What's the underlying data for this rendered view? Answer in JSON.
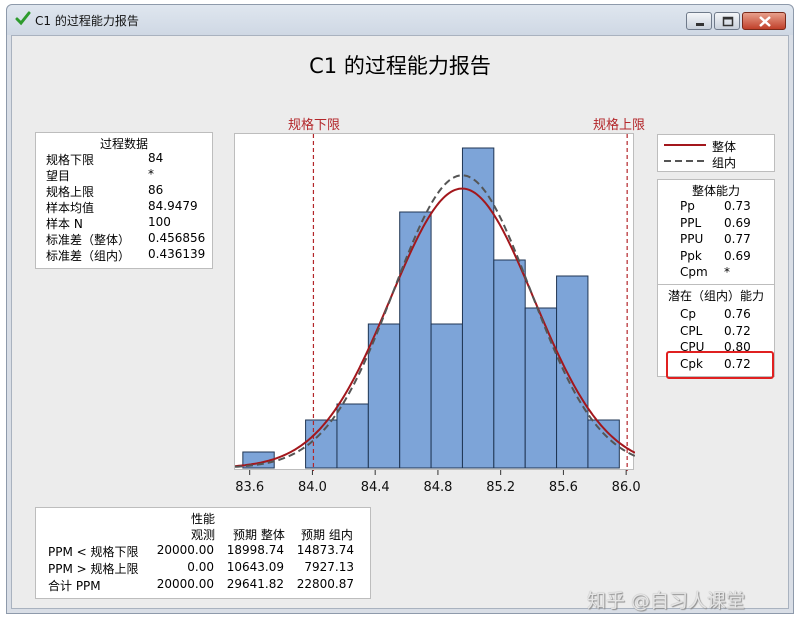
{
  "window": {
    "title": "C1 的过程能力报告"
  },
  "report": {
    "title": "C1 的过程能力报告"
  },
  "process_data": {
    "title": "过程数据",
    "rows": [
      {
        "label": "规格下限",
        "value": "84"
      },
      {
        "label": "望目",
        "value": "*"
      },
      {
        "label": "规格上限",
        "value": "86"
      },
      {
        "label": "样本均值",
        "value": "84.9479"
      },
      {
        "label": "样本 N",
        "value": "100"
      },
      {
        "label": "标准差（整体）",
        "value": "0.456856"
      },
      {
        "label": "标准差（组内）",
        "value": "0.436139"
      }
    ]
  },
  "legend": {
    "items": [
      {
        "label": "整体",
        "style": "solid",
        "color": "#a3171c"
      },
      {
        "label": "组内",
        "style": "dashed",
        "color": "#555555"
      }
    ]
  },
  "overall_capability": {
    "title": "整体能力",
    "rows": [
      {
        "label": "Pp",
        "value": "0.73"
      },
      {
        "label": "PPL",
        "value": "0.69"
      },
      {
        "label": "PPU",
        "value": "0.77"
      },
      {
        "label": "Ppk",
        "value": "0.69"
      },
      {
        "label": "Cpm",
        "value": "*"
      }
    ]
  },
  "potential_capability": {
    "title": "潜在（组内）能力",
    "rows": [
      {
        "label": "Cp",
        "value": "0.76"
      },
      {
        "label": "CPL",
        "value": "0.72"
      },
      {
        "label": "CPU",
        "value": "0.80"
      },
      {
        "label": "Cpk",
        "value": "0.72"
      }
    ]
  },
  "performance": {
    "title": "性能",
    "headers": [
      "观测",
      "预期 整体",
      "预期 组内"
    ],
    "rows": [
      {
        "label": "PPM < 规格下限",
        "values": [
          "20000.00",
          "18998.74",
          "14873.74"
        ]
      },
      {
        "label": "PPM > 规格上限",
        "values": [
          "0.00",
          "10643.09",
          "7927.13"
        ]
      },
      {
        "label": "合计 PPM",
        "values": [
          "20000.00",
          "29641.82",
          "22800.87"
        ]
      }
    ]
  },
  "watermark": "知乎 @自习人课堂",
  "colors": {
    "bar_fill": "#7da4d8",
    "bar_stroke": "#1f3553",
    "overall_curve": "#a3171c",
    "within_curve": "#555555",
    "spec_line": "#b3262a",
    "highlight": "#e02020"
  },
  "chart_data": {
    "type": "histogram",
    "title": "C1 的过程能力报告",
    "xlabel": "",
    "ylabel": "",
    "xlim": [
      83.5,
      86.05
    ],
    "ylim": [
      0,
      20
    ],
    "x_ticks": [
      83.6,
      84.0,
      84.4,
      84.8,
      85.2,
      85.6,
      86.0
    ],
    "x_tick_labels": [
      "83.6",
      "84.0",
      "84.4",
      "84.8",
      "85.2",
      "85.6",
      "86.0"
    ],
    "bin_width": 0.2,
    "bins": [
      {
        "x0": 83.55,
        "x1": 83.75,
        "count": 1
      },
      {
        "x0": 83.75,
        "x1": 83.95,
        "count": 0
      },
      {
        "x0": 83.95,
        "x1": 84.15,
        "count": 3
      },
      {
        "x0": 84.15,
        "x1": 84.35,
        "count": 4
      },
      {
        "x0": 84.35,
        "x1": 84.55,
        "count": 9
      },
      {
        "x0": 84.55,
        "x1": 84.75,
        "count": 16
      },
      {
        "x0": 84.75,
        "x1": 84.95,
        "count": 9
      },
      {
        "x0": 84.95,
        "x1": 85.15,
        "count": 20
      },
      {
        "x0": 85.15,
        "x1": 85.35,
        "count": 13
      },
      {
        "x0": 85.35,
        "x1": 85.55,
        "count": 10
      },
      {
        "x0": 85.55,
        "x1": 85.75,
        "count": 12
      },
      {
        "x0": 85.75,
        "x1": 85.95,
        "count": 3
      }
    ],
    "reference_lines": [
      {
        "label": "规格下限",
        "x": 84
      },
      {
        "label": "规格上限",
        "x": 86
      }
    ],
    "curves": [
      {
        "name": "整体",
        "type": "normal",
        "mean": 84.9479,
        "sd": 0.456856,
        "style": "solid"
      },
      {
        "name": "组内",
        "type": "normal",
        "mean": 84.9479,
        "sd": 0.436139,
        "style": "dashed"
      }
    ],
    "n": 100,
    "legend_position": "right"
  }
}
